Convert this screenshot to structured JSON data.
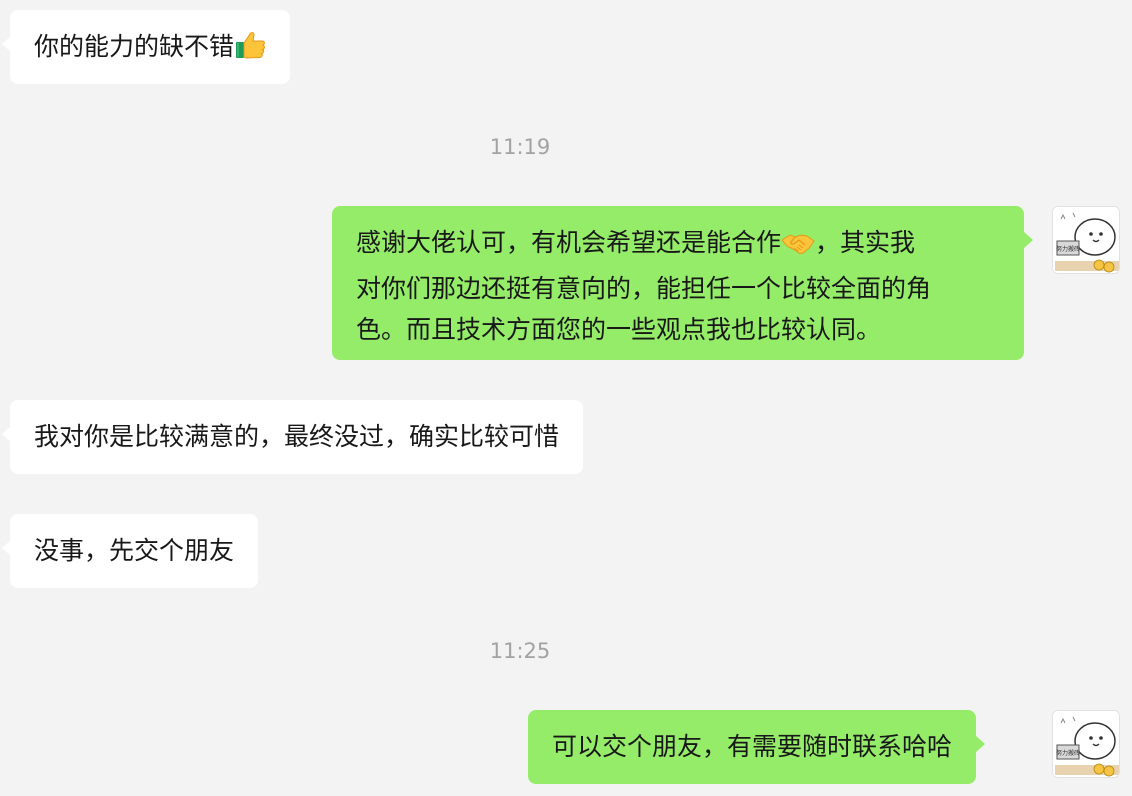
{
  "chat": {
    "messages": [
      {
        "side": "incoming",
        "text": "你的能力的缺不错",
        "emoji": "thumbs-up-icon"
      },
      {
        "side": "outgoing",
        "line1a": "感谢大佬认可，有机会希望还是能合作",
        "emoji": "handshake-icon",
        "line1b": "，其实我",
        "line2": "对你们那边还挺有意向的，能担任一个比较全面的角",
        "line3": "色。而且技术方面您的一些观点我也比较认同。"
      },
      {
        "side": "incoming",
        "text": "我对你是比较满意的，最终没过，确实比较可惜"
      },
      {
        "side": "incoming",
        "text": "没事，先交个朋友"
      },
      {
        "side": "outgoing",
        "text": "可以交个朋友，有需要随时联系哈哈"
      }
    ],
    "timestamps": [
      "11:19",
      "11:25"
    ],
    "avatar": {
      "icon": "cartoon-avatar-icon",
      "sign_text": "努力搬砖"
    }
  },
  "colors": {
    "background": "#f3f3f3",
    "incoming_bubble": "#ffffff",
    "outgoing_bubble": "#95ec69",
    "timestamp": "#a2a2a2"
  }
}
